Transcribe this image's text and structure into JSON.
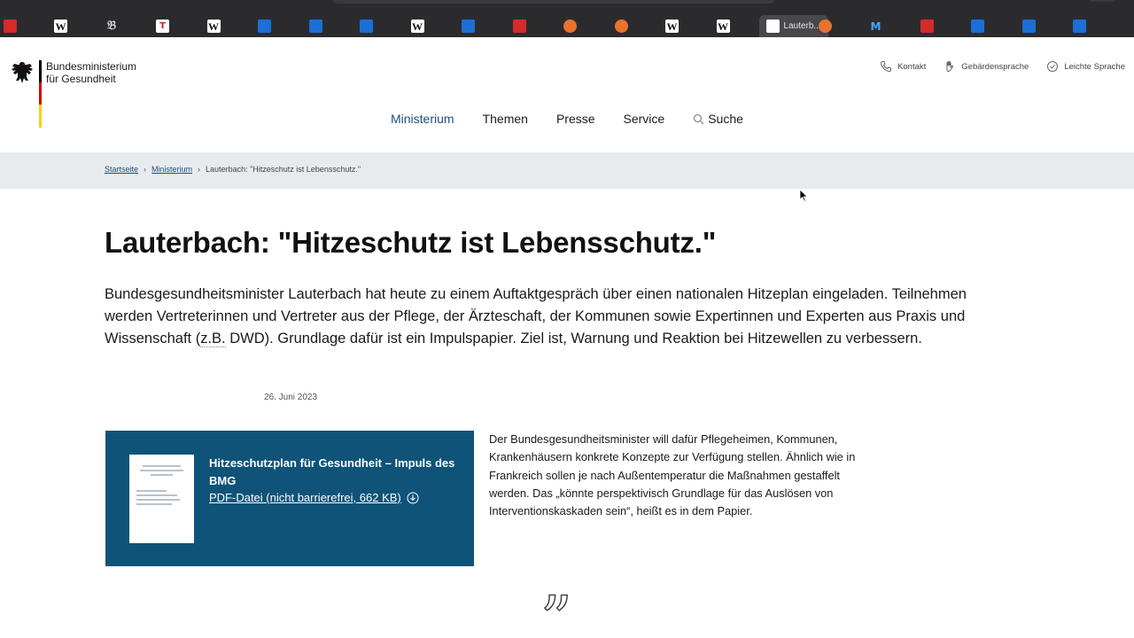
{
  "browser": {
    "tabs": [
      {
        "icon": "red-square-icon",
        "glyph": "",
        "active": false
      },
      {
        "icon": "wikipedia-icon",
        "glyph": "W",
        "active": false
      },
      {
        "icon": "gothic-b-icon",
        "glyph": "𝔅",
        "active": false
      },
      {
        "icon": "t-icon",
        "glyph": "T",
        "active": false
      },
      {
        "icon": "wikipedia-icon",
        "glyph": "W",
        "active": false
      },
      {
        "icon": "blue-shield-icon",
        "glyph": "",
        "active": false
      },
      {
        "icon": "blue-shield-icon",
        "glyph": "",
        "active": false
      },
      {
        "icon": "blue-shield-icon",
        "glyph": "",
        "active": false
      },
      {
        "icon": "wikipedia-icon",
        "glyph": "W",
        "active": false
      },
      {
        "icon": "blue-shield-icon",
        "glyph": "",
        "active": false
      },
      {
        "icon": "red-grid-icon",
        "glyph": "",
        "active": false
      },
      {
        "icon": "orange-circle-icon",
        "glyph": "",
        "active": false
      },
      {
        "icon": "orange-circle-icon",
        "glyph": "",
        "active": false
      },
      {
        "icon": "wikipedia-icon",
        "glyph": "W",
        "active": false
      },
      {
        "icon": "wikipedia-icon",
        "glyph": "W",
        "active": false
      },
      {
        "icon": "bmg-icon",
        "glyph": "",
        "active": true,
        "title": "Lauterb..."
      },
      {
        "icon": "orange-circle-icon",
        "glyph": "",
        "active": false
      },
      {
        "icon": "m-icon",
        "glyph": "M",
        "active": false
      },
      {
        "icon": "red-square-icon",
        "glyph": "",
        "active": false
      },
      {
        "icon": "blue-shield-icon",
        "glyph": "",
        "active": false
      },
      {
        "icon": "blue-shield-icon",
        "glyph": "",
        "active": false
      },
      {
        "icon": "grid-icon",
        "glyph": "",
        "active": false
      }
    ]
  },
  "header": {
    "logo_line1": "Bundesministerium",
    "logo_line2": "für Gesundheit",
    "meta": {
      "contact": "Kontakt",
      "sign_language": "Gebärdensprache",
      "easy_language": "Leichte Sprache"
    },
    "nav": {
      "ministry": "Ministerium",
      "topics": "Themen",
      "press": "Presse",
      "service": "Service",
      "search": "Suche"
    }
  },
  "breadcrumb": {
    "home": "Startseite",
    "ministry": "Ministerium",
    "current": "Lauterbach: \"Hitzeschutz ist Lebensschutz.\""
  },
  "article": {
    "title": "Lauterbach: \"Hitzeschutz ist Lebensschutz.\"",
    "lead_part1": "Bundesgesundheitsminister Lauterbach hat heute zu einem Auftaktgespräch über einen nationalen Hitzeplan eingeladen. Teilnehmen werden Vertreterinnen und Vertreter aus der Pflege, der Ärzteschaft, der Kommunen sowie Expertinnen und Experten aus Praxis und Wissenschaft (",
    "lead_abbr": "z.B.",
    "lead_part2": " DWD). Grundlage dafür ist ein Impulspapier. Ziel ist, Warnung und Reaktion bei Hitzewellen zu verbessern.",
    "date": "26. Juni 2023",
    "download": {
      "title": "Hitzeschutzplan für Gesundheit – Impuls des BMG",
      "link": "PDF-Datei (nicht barrierefrei, 662 KB)"
    },
    "body": "Der Bundesgesundheitsminister will dafür Pflegeheimen, Kommunen, Krankenhäusern konkrete Konzepte zur Verfügung stellen. Ähnlich wie in Frankreich sollen je nach Außentemperatur die Maßnahmen gestaffelt werden. Das „könnte perspektivisch Grundlage für das Auslösen von Interventionskaskaden sein“, heißt es in dem Papier.",
    "quote_glyph": "”"
  }
}
